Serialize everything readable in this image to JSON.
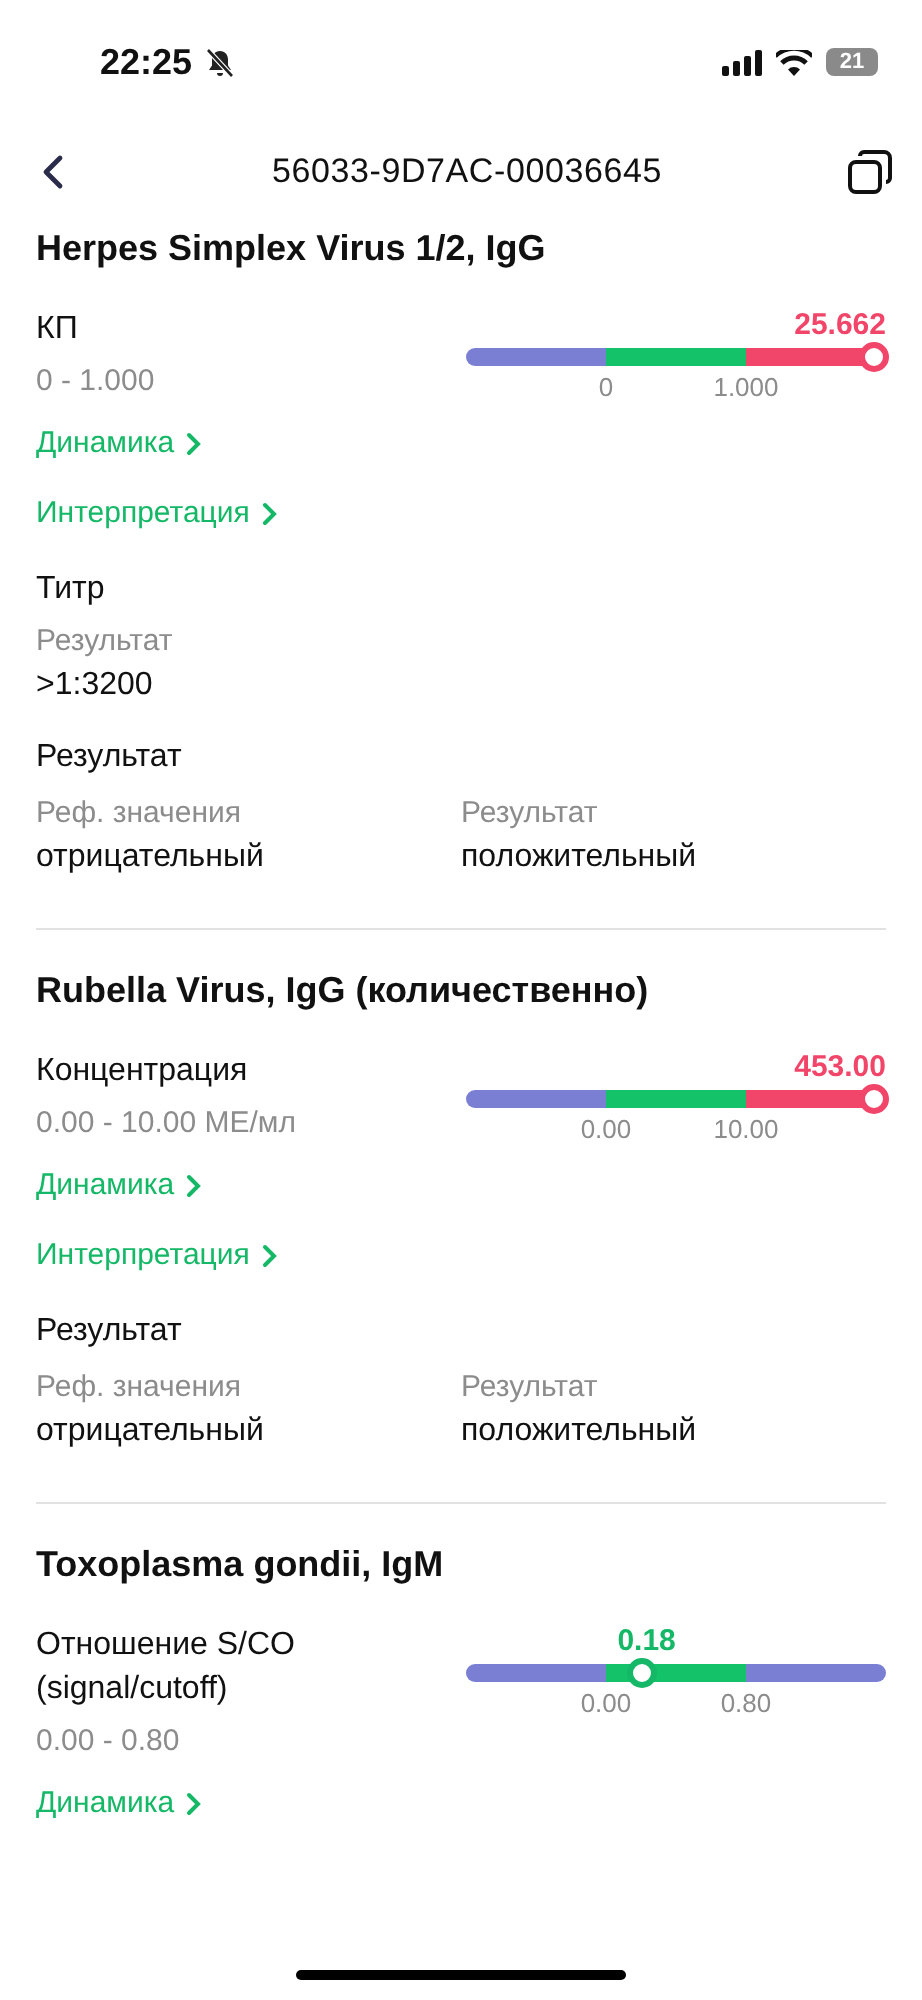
{
  "status_bar": {
    "time": "22:25",
    "battery": "21"
  },
  "header": {
    "title": "56033-9D7AC-00036645"
  },
  "tests": [
    {
      "title": "Herpes Simplex Virus 1/2, IgG",
      "items": [
        {
          "kind": "gauge",
          "label": "КП",
          "range": "0 - 1.000",
          "value": "25.662",
          "color": "#f2456a",
          "level": 1,
          "ticks": [
            "0",
            "1.000"
          ]
        },
        {
          "kind": "link",
          "label": "Динамика"
        },
        {
          "kind": "link",
          "label": "Интерпретация"
        },
        {
          "kind": "text",
          "label": "Титр",
          "sublabel": "Результат",
          "value": ">1:3200"
        },
        {
          "kind": "pair",
          "label": "Результат",
          "columns": [
            {
              "label": "Реф. значения",
              "value": "отрицательный"
            },
            {
              "label": "Результат",
              "value": "положительный"
            }
          ]
        }
      ]
    },
    {
      "title": "Rubella Virus, IgG (количественно)",
      "items": [
        {
          "kind": "gauge",
          "label": "Концентрация",
          "range": "0.00 - 10.00 МЕ/мл",
          "value": "453.00",
          "color": "#f2456a",
          "level": 1,
          "ticks": [
            "0.00",
            "10.00"
          ]
        },
        {
          "kind": "link",
          "label": "Динамика"
        },
        {
          "kind": "link",
          "label": "Интерпретация"
        },
        {
          "kind": "pair",
          "label": "Результат",
          "columns": [
            {
              "label": "Реф. значения",
              "value": "отрицательный"
            },
            {
              "label": "Результат",
              "value": "положительный"
            }
          ]
        }
      ]
    },
    {
      "title": "Toxoplasma gondii, IgM",
      "items": [
        {
          "kind": "gauge",
          "label": "Отношение S/CO (signal/cutoff)",
          "range": "0.00 - 0.80",
          "value": "0.18",
          "color": "#14b866",
          "level": 0.43,
          "ticks": [
            "0.00",
            "0.80"
          ]
        },
        {
          "kind": "link",
          "label": "Динамика"
        }
      ]
    }
  ]
}
